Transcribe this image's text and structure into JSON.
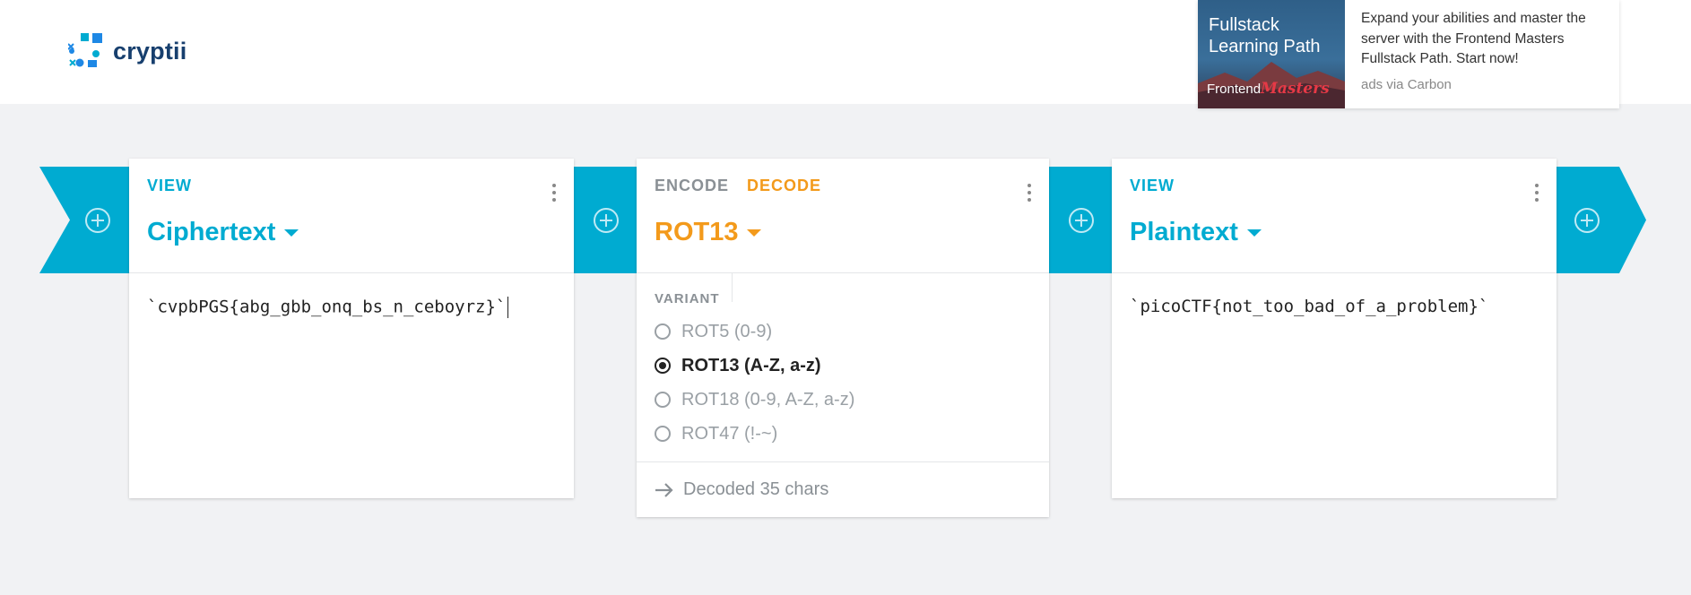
{
  "app": {
    "name": "cryptii"
  },
  "ad": {
    "image_title": "Fullstack Learning Path",
    "image_brand_prefix": "Frontend",
    "image_brand_name": "Masters",
    "text": "Expand your abilities and master the server with the Frontend Masters Fullstack Path. Start now!",
    "via": "ads via Carbon"
  },
  "cards": {
    "left": {
      "label": "VIEW",
      "title": "Ciphertext",
      "content": "`cvpbPGS{abg_gbb_onq_bs_n_ceboyrz}`"
    },
    "middle": {
      "encode_label": "ENCODE",
      "decode_label": "DECODE",
      "title": "ROT13",
      "variant_label": "VARIANT",
      "variants": [
        "ROT5 (0-9)",
        "ROT13 (A-Z, a-z)",
        "ROT18 (0-9, A-Z, a-z)",
        "ROT47 (!-~)"
      ],
      "selected_variant": "ROT13 (A-Z, a-z)",
      "status": "Decoded 35 chars"
    },
    "right": {
      "label": "VIEW",
      "title": "Plaintext",
      "content": "`picoCTF{not_too_bad_of_a_problem}`"
    }
  },
  "colors": {
    "accent": "#00abd1",
    "decode": "#f39a1b",
    "brand": "#173f6e"
  },
  "icons": [
    "logo-icon",
    "add-icon",
    "more-vert-icon",
    "caret-down-icon",
    "arrow-right-icon",
    "radio-icon"
  ]
}
